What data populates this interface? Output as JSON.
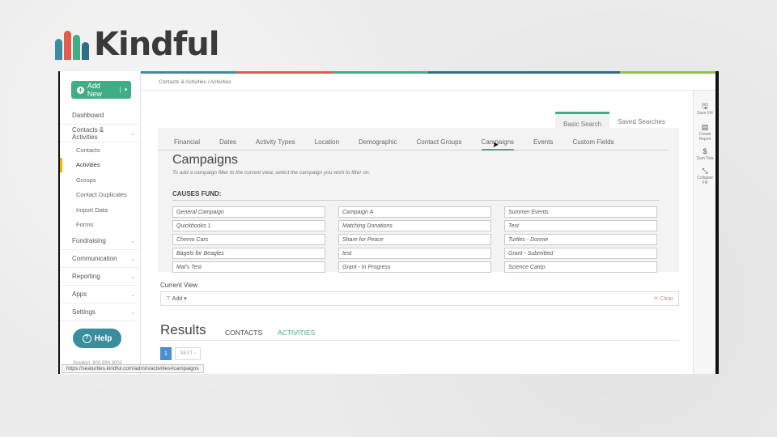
{
  "logo": {
    "text": "Kindful",
    "bar_colors": [
      "#3b8d9d",
      "#e35a4f",
      "#3fae85",
      "#2f6e86"
    ]
  },
  "sidebar": {
    "add_new_label": "Add New",
    "items": [
      {
        "label": "Dashboard"
      },
      {
        "label": "Contacts & Activities"
      },
      {
        "label": "Fundraising"
      },
      {
        "label": "Communication"
      },
      {
        "label": "Reporting"
      },
      {
        "label": "Apps"
      },
      {
        "label": "Settings"
      }
    ],
    "sub_items": [
      {
        "label": "Contacts"
      },
      {
        "label": "Activities"
      },
      {
        "label": "Groups"
      },
      {
        "label": "Contact Duplicates"
      },
      {
        "label": "Import Data"
      },
      {
        "label": "Forms"
      }
    ],
    "help_label": "Help",
    "support_text": "Support: 800.994.3002"
  },
  "status_url": "https://seaturtles.kindful.com/admin/activities#campaigns",
  "breadcrumb": "Contacts & Activities  /  Activities",
  "top_stripe_colors": [
    "#3b8d9d",
    "#e35a4f",
    "#3fae85",
    "#2f6e86",
    "#2f6e86",
    "#8cc63f"
  ],
  "right_tools": [
    {
      "icon": "save-icon",
      "label1": "Save Filt",
      "label2": ""
    },
    {
      "icon": "report-icon",
      "label1": "Create",
      "label2": "Report"
    },
    {
      "icon": "dollar-icon",
      "label1": "Sum Tota",
      "label2": ""
    },
    {
      "icon": "collapse-icon",
      "label1": "Collapse",
      "label2": "Filt"
    }
  ],
  "search_tabs": {
    "basic": "Basic Search",
    "saved": "Saved Searches"
  },
  "filter_tabs": [
    {
      "label": "Financial"
    },
    {
      "label": "Dates"
    },
    {
      "label": "Activity Types"
    },
    {
      "label": "Location"
    },
    {
      "label": "Demographic"
    },
    {
      "label": "Contact Groups"
    },
    {
      "label": "Campaigns"
    },
    {
      "label": "Events"
    },
    {
      "label": "Custom Fields"
    }
  ],
  "campaigns": {
    "title": "Campaigns",
    "subtitle": "To add a campaign filter to the current view, select the campaign you wish to filter on.",
    "section_label": "CAUSES FUND:",
    "items": [
      "General Campaign",
      "Campaign A",
      "Summer Events",
      "Quickbooks 1",
      "Matching Donations",
      "Test",
      "Chemo Cars",
      "Share for Peace",
      "Turtles - Donnie",
      "Bagels for Beagles",
      "test",
      "Grant - Submitted",
      "Mal's Test",
      "Grant - In Progress",
      "Science Camp"
    ]
  },
  "current_view": {
    "label": "Current View",
    "add_label": "Add",
    "clear_label": "Clear"
  },
  "results": {
    "title": "Results",
    "tab_contacts": "CONTACTS",
    "tab_activities": "ACTIVITIES",
    "page": "1",
    "next": "NEXT ›"
  }
}
